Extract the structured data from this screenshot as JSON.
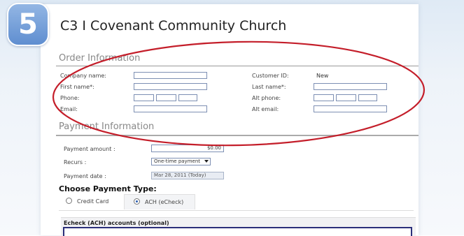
{
  "step_number": "5",
  "church_title": "C3 I Covenant Community Church",
  "order": {
    "section_title": "Order Information",
    "company_label": "Company name:",
    "customer_id_label": "Customer ID:",
    "customer_id_value": "New",
    "first_name_label": "First name*:",
    "last_name_label": "Last name*:",
    "phone_label": "Phone:",
    "alt_phone_label": "Alt phone:",
    "email_label": "Email:",
    "alt_email_label": "Alt email:"
  },
  "payment": {
    "section_title": "Payment Information",
    "amount_label": "Payment amount :",
    "amount_value": "$0.00",
    "recurs_label": "Recurs :",
    "recurs_value": "One-time payment",
    "date_label": "Payment date :",
    "date_value": "Mar 28, 2011 (Today)"
  },
  "payment_type": {
    "title": "Choose Payment Type:",
    "options": [
      {
        "label": "Credit Card",
        "selected": false
      },
      {
        "label": "ACH (eCheck)",
        "selected": true
      }
    ]
  },
  "echeck": {
    "title": "Echeck (ACH) accounts (optional)"
  },
  "colors": {
    "badge": "#6f9bd8",
    "annotation_ellipse": "#c41e2a",
    "field_border": "#7d8fb3"
  }
}
